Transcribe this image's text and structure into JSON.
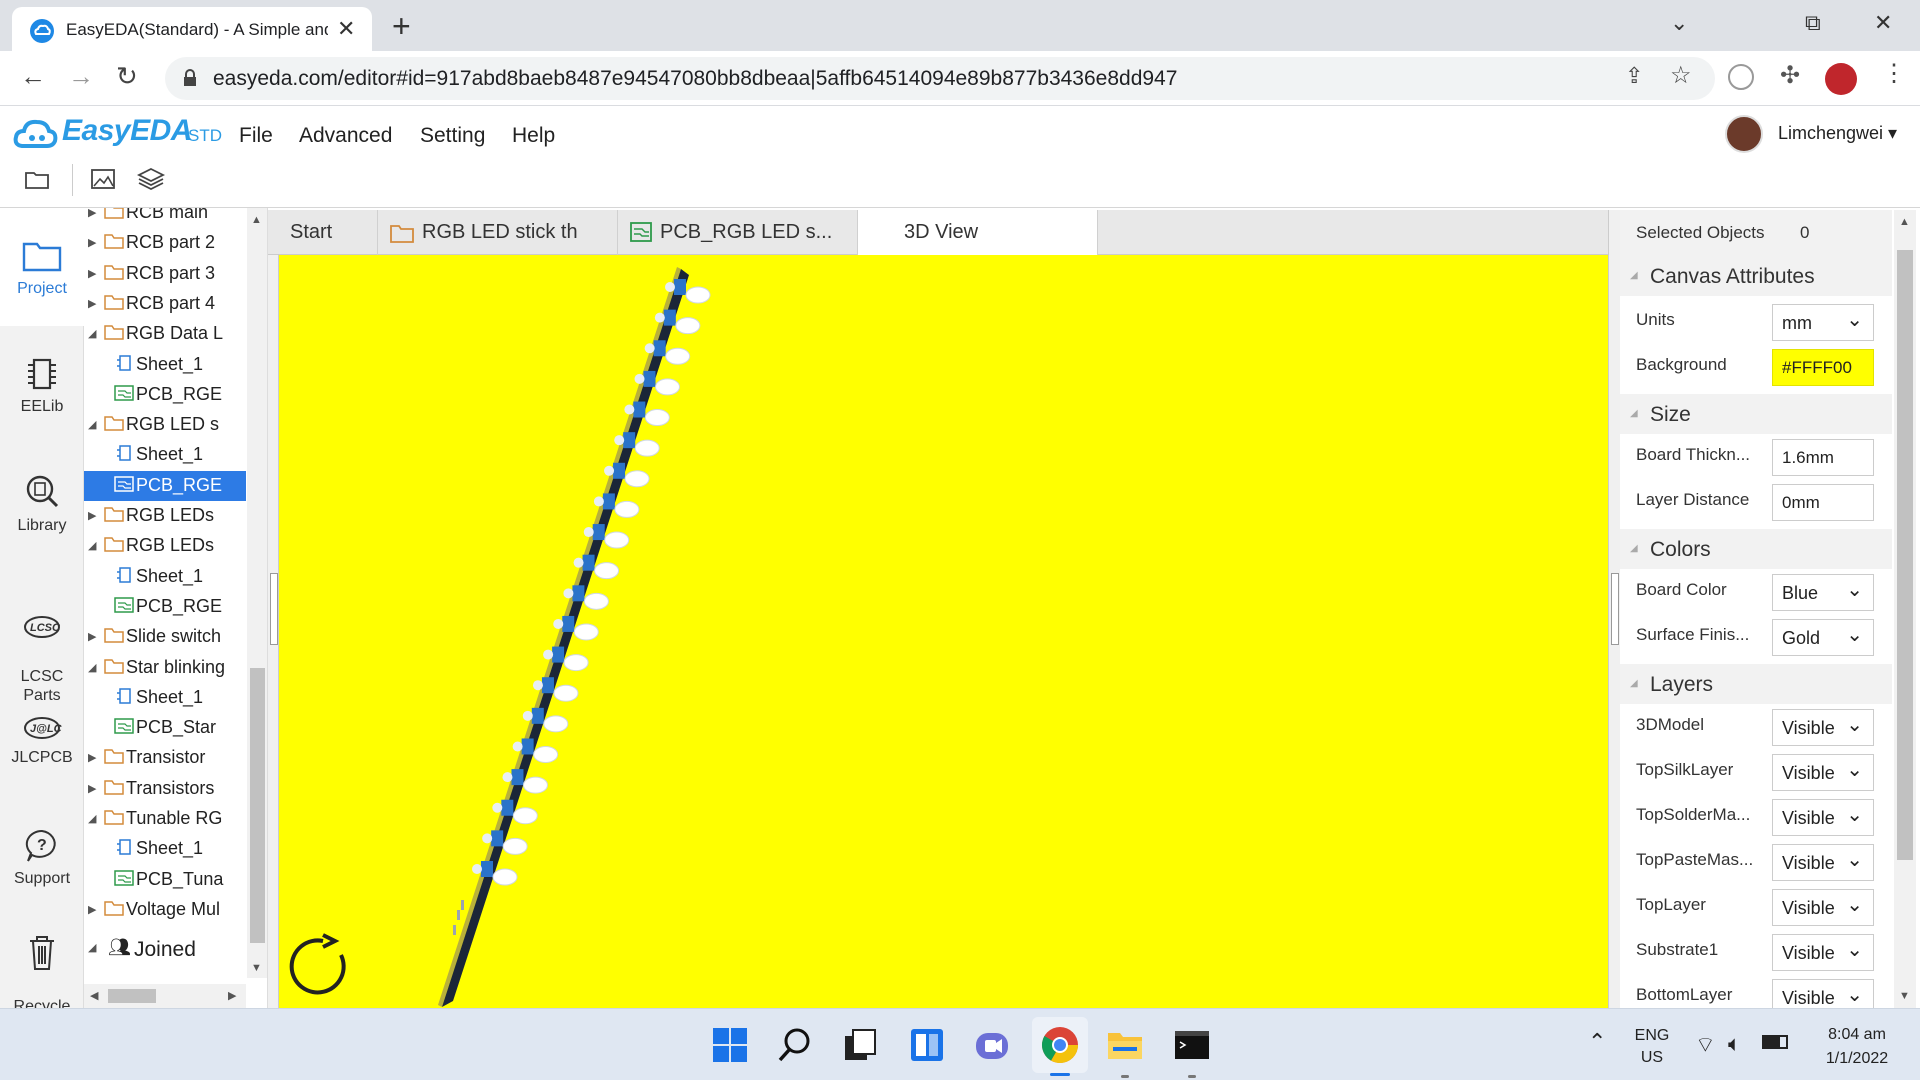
{
  "browser": {
    "tab_title": "EasyEDA(Standard) - A Simple and Powerful Electronic Circuit Design Tool",
    "tab_close": "✕",
    "new_tab": "+",
    "url": "easyeda.com/editor#id=917abd8baeb8487e94547080bb8dbeaa|5affb64514094e89b877b3436e8dd947",
    "window_buttons": [
      "⌄",
      "⧉",
      "✕"
    ]
  },
  "menubar": {
    "logo": "EasyEDA",
    "logo_suffix": "STD",
    "menus": [
      "File",
      "Advanced",
      "Setting",
      "Help"
    ],
    "user_name": "Limchengwei ▾"
  },
  "leftnav": [
    {
      "label": "Project",
      "icon": "folder-icon",
      "active": true
    },
    {
      "label": "EELib",
      "icon": "chip-icon"
    },
    {
      "label": "Library",
      "icon": "library-search-icon"
    },
    {
      "label": "LCSC\nParts",
      "icon": "lcsc-logo-icon"
    },
    {
      "label": "JLCPCB",
      "icon": "jlc-logo-icon"
    },
    {
      "label": "Support",
      "icon": "question-icon"
    },
    {
      "label": "Recycle\nBin",
      "icon": "trash-icon"
    }
  ],
  "tree": {
    "items": [
      {
        "label": "RCB main",
        "type": "folder",
        "level": 0,
        "expanded": false
      },
      {
        "label": "RCB part 2",
        "type": "folder",
        "level": 0,
        "expanded": false
      },
      {
        "label": "RCB part 3",
        "type": "folder",
        "level": 0,
        "expanded": false
      },
      {
        "label": "RCB part 4",
        "type": "folder",
        "level": 0,
        "expanded": false
      },
      {
        "label": "RGB Data L",
        "type": "folder",
        "level": 0,
        "expanded": true
      },
      {
        "label": "Sheet_1",
        "type": "sheet",
        "level": 1
      },
      {
        "label": "PCB_RGE",
        "type": "pcb",
        "level": 1
      },
      {
        "label": "RGB LED s",
        "type": "folder",
        "level": 0,
        "expanded": true
      },
      {
        "label": "Sheet_1",
        "type": "sheet",
        "level": 1
      },
      {
        "label": "PCB_RGE",
        "type": "pcb",
        "level": 1,
        "selected": true
      },
      {
        "label": "RGB LEDs",
        "type": "folder",
        "level": 0,
        "expanded": false
      },
      {
        "label": "RGB LEDs",
        "type": "folder",
        "level": 0,
        "expanded": true
      },
      {
        "label": "Sheet_1",
        "type": "sheet",
        "level": 1
      },
      {
        "label": "PCB_RGE",
        "type": "pcb",
        "level": 1
      },
      {
        "label": "Slide switch",
        "type": "folder",
        "level": 0,
        "expanded": false
      },
      {
        "label": "Star blinking",
        "type": "folder",
        "level": 0,
        "expanded": true
      },
      {
        "label": "Sheet_1",
        "type": "sheet",
        "level": 1
      },
      {
        "label": "PCB_Star",
        "type": "pcb",
        "level": 1
      },
      {
        "label": "Transistor",
        "type": "folder",
        "level": 0,
        "expanded": false
      },
      {
        "label": "Transistors",
        "type": "folder",
        "level": 0,
        "expanded": false
      },
      {
        "label": "Tunable RG",
        "type": "folder",
        "level": 0,
        "expanded": true
      },
      {
        "label": "Sheet_1",
        "type": "sheet",
        "level": 1
      },
      {
        "label": "PCB_Tuna",
        "type": "pcb",
        "level": 1
      },
      {
        "label": "Voltage Mul",
        "type": "folder",
        "level": 0,
        "expanded": false
      }
    ],
    "joined": "Joined"
  },
  "editor_tabs": [
    {
      "label": "Start"
    },
    {
      "label": "RGB LED stick th",
      "icon": "folder-icon"
    },
    {
      "label": "PCB_RGB LED s...",
      "icon": "pcb-icon"
    },
    {
      "label": "3D View",
      "active": true
    }
  ],
  "canvas": {
    "background": "#FFFF00"
  },
  "rpanel": {
    "selected_label": "Selected Objects",
    "selected_count": "0",
    "sections": {
      "canvas": "Canvas Attributes",
      "size": "Size",
      "colors": "Colors",
      "layers": "Layers"
    },
    "units_label": "Units",
    "units_value": "mm",
    "background_label": "Background",
    "background_value": "#FFFF00",
    "thickness_label": "Board Thickn...",
    "thickness_value": "1.6mm",
    "distance_label": "Layer Distance",
    "distance_value": "0mm",
    "board_color_label": "Board Color",
    "board_color_value": "Blue",
    "finish_label": "Surface Finis...",
    "finish_value": "Gold",
    "layers": [
      {
        "name": "3DModel",
        "value": "Visible"
      },
      {
        "name": "TopSilkLayer",
        "value": "Visible"
      },
      {
        "name": "TopSolderMa...",
        "value": "Visible"
      },
      {
        "name": "TopPasteMas...",
        "value": "Visible"
      },
      {
        "name": "TopLayer",
        "value": "Visible"
      },
      {
        "name": "Substrate1",
        "value": "Visible"
      },
      {
        "name": "BottomLayer",
        "value": "Visible"
      }
    ]
  },
  "taskbar": {
    "lang_top": "ENG",
    "lang_bottom": "US",
    "time": "8:04 am",
    "date": "1/1/2022"
  }
}
